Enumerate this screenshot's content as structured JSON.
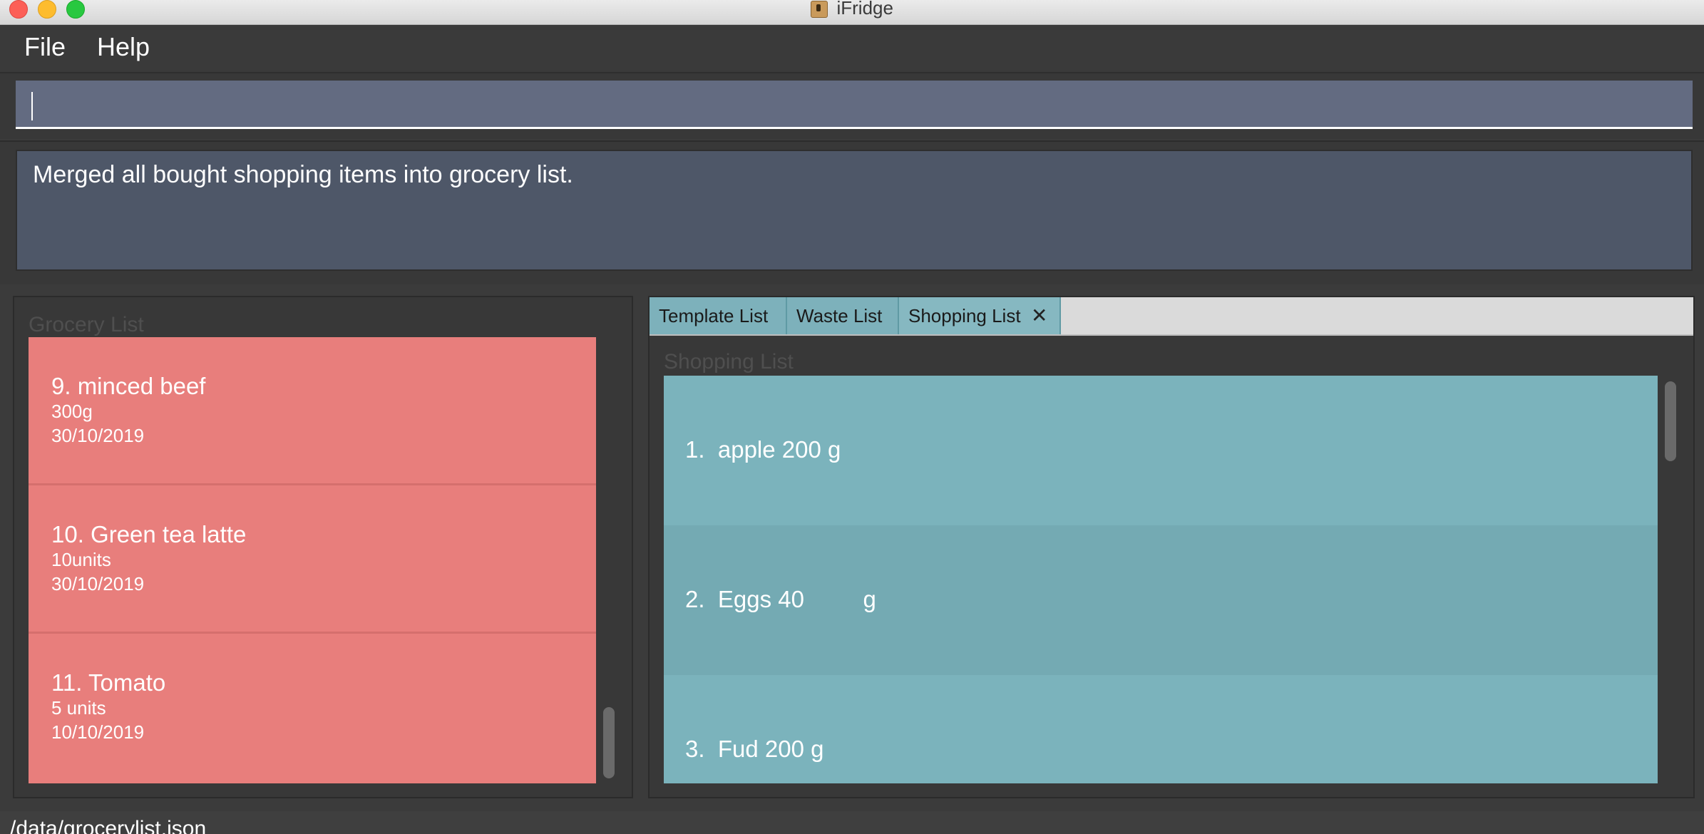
{
  "window": {
    "title": "iFridge"
  },
  "menu": {
    "file": "File",
    "help": "Help"
  },
  "command": {
    "value": ""
  },
  "result": {
    "text": "Merged all bought shopping items into grocery list."
  },
  "grocery": {
    "label": "Grocery List",
    "items": [
      {
        "name": "9.  minced beef",
        "amount": "300g",
        "date": "30/10/2019"
      },
      {
        "name": "10.  Green tea latte",
        "amount": "10units",
        "date": "30/10/2019"
      },
      {
        "name": "11.  Tomato",
        "amount": "5 units",
        "date": "10/10/2019"
      }
    ]
  },
  "tabs": {
    "template": "Template List",
    "waste": "Waste List",
    "shopping": "Shopping List",
    "close": "✕"
  },
  "shopping": {
    "label": "Shopping List",
    "items": [
      {
        "text": "1.  apple 200 g"
      },
      {
        "text": "2.  Eggs 40         g"
      },
      {
        "text": "3.  Fud 200 g"
      }
    ]
  },
  "status": {
    "path": "/data/grocerylist.json"
  },
  "colors": {
    "grocery_card": "#e87e7c",
    "shopping_card": "#7bb3bc",
    "command_box": "#636b81",
    "result_box": "#4e5768"
  }
}
